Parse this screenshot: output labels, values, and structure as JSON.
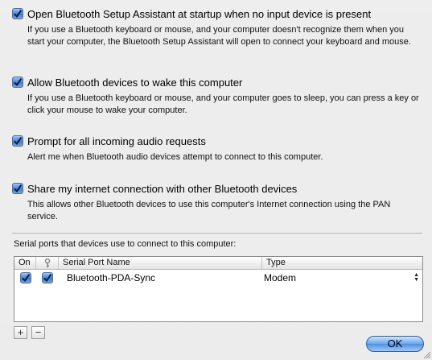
{
  "options": [
    {
      "label": "Open Bluetooth Setup Assistant at startup when no input device is present",
      "description": "If you use a Bluetooth keyboard or mouse, and your computer doesn't recognize them when you start your computer, the Bluetooth Setup Assistant will open to connect your keyboard and mouse.",
      "checked": true
    },
    {
      "label": "Allow Bluetooth devices to wake this computer",
      "description": "If you use a Bluetooth keyboard or mouse, and your computer goes to sleep, you can press a key or click your mouse to wake your computer.",
      "checked": true
    },
    {
      "label": "Prompt for all incoming audio requests",
      "description": "Alert me when Bluetooth audio devices attempt to connect to this computer.",
      "checked": true
    },
    {
      "label": "Share my internet connection with other Bluetooth devices",
      "description": "This allows other Bluetooth devices to use this computer's Internet connection using the PAN service.",
      "checked": true
    }
  ],
  "serial": {
    "label": "Serial ports that devices use to connect to this computer:",
    "columns": {
      "on": "On",
      "name": "Serial Port Name",
      "type": "Type"
    },
    "rows": [
      {
        "on": true,
        "secure": true,
        "name": "Bluetooth-PDA-Sync",
        "type": "Modem"
      }
    ]
  },
  "buttons": {
    "add": "+",
    "remove": "−",
    "ok": "OK"
  },
  "icons": {
    "key_column": "key-icon",
    "stepper": "stepper-arrows-icon"
  },
  "colors": {
    "accent": "#3d80d9",
    "ok_button": "#6aa5ea"
  }
}
